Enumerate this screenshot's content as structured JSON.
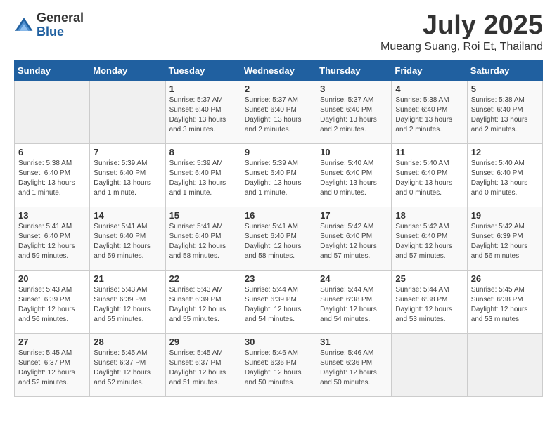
{
  "logo": {
    "general": "General",
    "blue": "Blue"
  },
  "title": "July 2025",
  "location": "Mueang Suang, Roi Et, Thailand",
  "days_of_week": [
    "Sunday",
    "Monday",
    "Tuesday",
    "Wednesday",
    "Thursday",
    "Friday",
    "Saturday"
  ],
  "weeks": [
    [
      {
        "day": "",
        "info": ""
      },
      {
        "day": "",
        "info": ""
      },
      {
        "day": "1",
        "info": "Sunrise: 5:37 AM\nSunset: 6:40 PM\nDaylight: 13 hours and 3 minutes."
      },
      {
        "day": "2",
        "info": "Sunrise: 5:37 AM\nSunset: 6:40 PM\nDaylight: 13 hours and 2 minutes."
      },
      {
        "day": "3",
        "info": "Sunrise: 5:37 AM\nSunset: 6:40 PM\nDaylight: 13 hours and 2 minutes."
      },
      {
        "day": "4",
        "info": "Sunrise: 5:38 AM\nSunset: 6:40 PM\nDaylight: 13 hours and 2 minutes."
      },
      {
        "day": "5",
        "info": "Sunrise: 5:38 AM\nSunset: 6:40 PM\nDaylight: 13 hours and 2 minutes."
      }
    ],
    [
      {
        "day": "6",
        "info": "Sunrise: 5:38 AM\nSunset: 6:40 PM\nDaylight: 13 hours and 1 minute."
      },
      {
        "day": "7",
        "info": "Sunrise: 5:39 AM\nSunset: 6:40 PM\nDaylight: 13 hours and 1 minute."
      },
      {
        "day": "8",
        "info": "Sunrise: 5:39 AM\nSunset: 6:40 PM\nDaylight: 13 hours and 1 minute."
      },
      {
        "day": "9",
        "info": "Sunrise: 5:39 AM\nSunset: 6:40 PM\nDaylight: 13 hours and 1 minute."
      },
      {
        "day": "10",
        "info": "Sunrise: 5:40 AM\nSunset: 6:40 PM\nDaylight: 13 hours and 0 minutes."
      },
      {
        "day": "11",
        "info": "Sunrise: 5:40 AM\nSunset: 6:40 PM\nDaylight: 13 hours and 0 minutes."
      },
      {
        "day": "12",
        "info": "Sunrise: 5:40 AM\nSunset: 6:40 PM\nDaylight: 13 hours and 0 minutes."
      }
    ],
    [
      {
        "day": "13",
        "info": "Sunrise: 5:41 AM\nSunset: 6:40 PM\nDaylight: 12 hours and 59 minutes."
      },
      {
        "day": "14",
        "info": "Sunrise: 5:41 AM\nSunset: 6:40 PM\nDaylight: 12 hours and 59 minutes."
      },
      {
        "day": "15",
        "info": "Sunrise: 5:41 AM\nSunset: 6:40 PM\nDaylight: 12 hours and 58 minutes."
      },
      {
        "day": "16",
        "info": "Sunrise: 5:41 AM\nSunset: 6:40 PM\nDaylight: 12 hours and 58 minutes."
      },
      {
        "day": "17",
        "info": "Sunrise: 5:42 AM\nSunset: 6:40 PM\nDaylight: 12 hours and 57 minutes."
      },
      {
        "day": "18",
        "info": "Sunrise: 5:42 AM\nSunset: 6:40 PM\nDaylight: 12 hours and 57 minutes."
      },
      {
        "day": "19",
        "info": "Sunrise: 5:42 AM\nSunset: 6:39 PM\nDaylight: 12 hours and 56 minutes."
      }
    ],
    [
      {
        "day": "20",
        "info": "Sunrise: 5:43 AM\nSunset: 6:39 PM\nDaylight: 12 hours and 56 minutes."
      },
      {
        "day": "21",
        "info": "Sunrise: 5:43 AM\nSunset: 6:39 PM\nDaylight: 12 hours and 55 minutes."
      },
      {
        "day": "22",
        "info": "Sunrise: 5:43 AM\nSunset: 6:39 PM\nDaylight: 12 hours and 55 minutes."
      },
      {
        "day": "23",
        "info": "Sunrise: 5:44 AM\nSunset: 6:39 PM\nDaylight: 12 hours and 54 minutes."
      },
      {
        "day": "24",
        "info": "Sunrise: 5:44 AM\nSunset: 6:38 PM\nDaylight: 12 hours and 54 minutes."
      },
      {
        "day": "25",
        "info": "Sunrise: 5:44 AM\nSunset: 6:38 PM\nDaylight: 12 hours and 53 minutes."
      },
      {
        "day": "26",
        "info": "Sunrise: 5:45 AM\nSunset: 6:38 PM\nDaylight: 12 hours and 53 minutes."
      }
    ],
    [
      {
        "day": "27",
        "info": "Sunrise: 5:45 AM\nSunset: 6:37 PM\nDaylight: 12 hours and 52 minutes."
      },
      {
        "day": "28",
        "info": "Sunrise: 5:45 AM\nSunset: 6:37 PM\nDaylight: 12 hours and 52 minutes."
      },
      {
        "day": "29",
        "info": "Sunrise: 5:45 AM\nSunset: 6:37 PM\nDaylight: 12 hours and 51 minutes."
      },
      {
        "day": "30",
        "info": "Sunrise: 5:46 AM\nSunset: 6:36 PM\nDaylight: 12 hours and 50 minutes."
      },
      {
        "day": "31",
        "info": "Sunrise: 5:46 AM\nSunset: 6:36 PM\nDaylight: 12 hours and 50 minutes."
      },
      {
        "day": "",
        "info": ""
      },
      {
        "day": "",
        "info": ""
      }
    ]
  ]
}
